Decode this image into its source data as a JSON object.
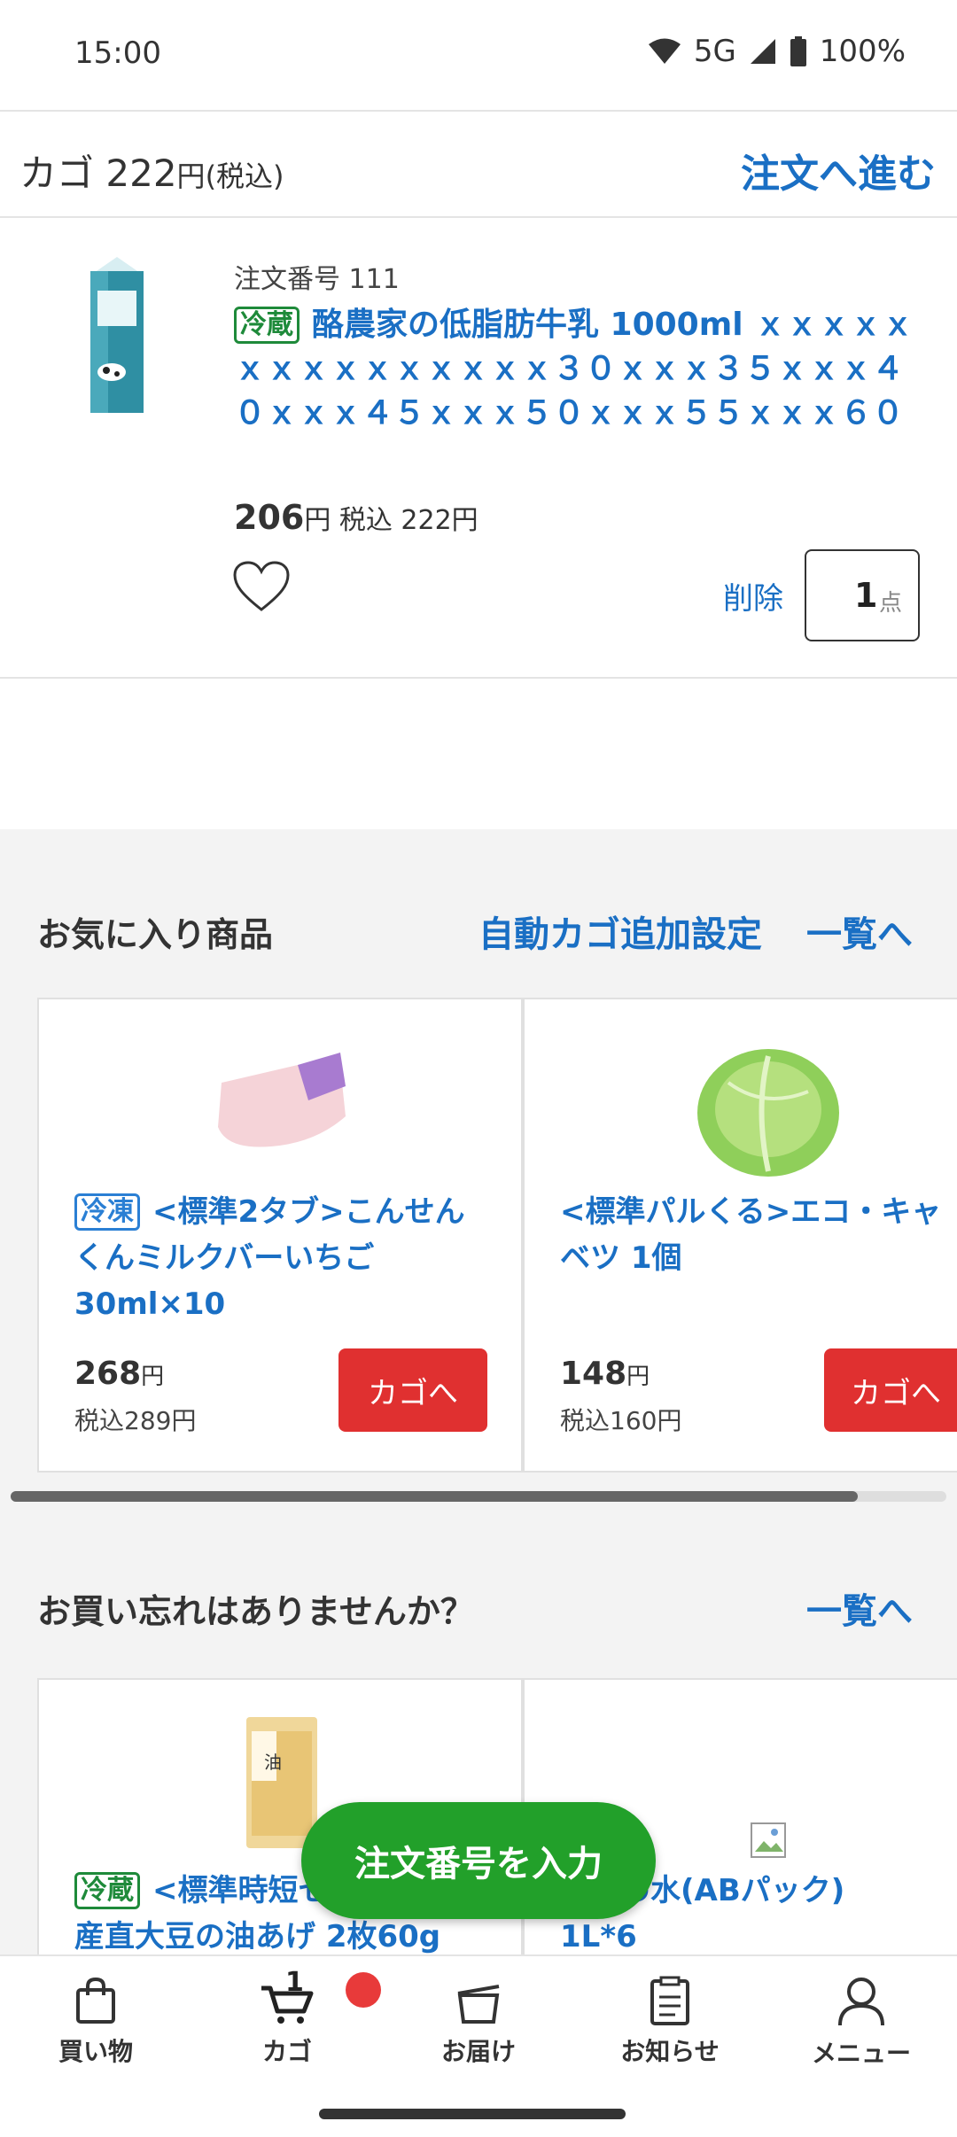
{
  "status_bar": {
    "time": "15:00",
    "network": "5G",
    "battery": "100%"
  },
  "cart_header": {
    "label": "カゴ",
    "total": "222",
    "unit": "円",
    "tax_note": "(税込)",
    "proceed_label": "注文へ進む"
  },
  "cart_item": {
    "order_number": "注文番号 111",
    "badge": "冷蔵",
    "name": "酪農家の低脂肪牛乳 1000ml ｘｘｘｘｘｘｘｘｘｘｘｘｘｘｘ３０ｘｘｘ３５ｘｘｘ４０ｘｘｘ４５ｘｘｘ５０ｘｘｘ５５ｘｘｘ６０",
    "price": "206",
    "price_unit": "円",
    "price_tax": "税込 222円",
    "delete_label": "削除",
    "quantity": "1",
    "quantity_unit": "点"
  },
  "favorites": {
    "title": "お気に入り商品",
    "auto_add_label": "自動カゴ追加設定",
    "list_link": "一覧へ",
    "products": [
      {
        "badge": "冷凍",
        "name_line1": "<標準2タブ>こんせん",
        "name_line2": "くんミルクバーいちご",
        "name_line3": "30ml×10",
        "price": "268",
        "price_unit": "円",
        "tax_price": "税込289円",
        "add_label": "カゴへ"
      },
      {
        "name_line1": "<標準パルくる>エコ・キャ",
        "name_line2": "ベツ 1個",
        "price": "148",
        "price_unit": "円",
        "tax_price": "税込160円",
        "add_label": "カゴへ"
      }
    ]
  },
  "forgotten": {
    "title": "お買い忘れはありませんか？",
    "list_link": "一覧へ",
    "products": [
      {
        "badge": "冷蔵",
        "name_line1": "<標準時短セ",
        "name_line2": "産直大豆の油あげ 2枚60g"
      },
      {
        "name_line1": "み野の水(ABパック)",
        "name_line2": "1L*6"
      }
    ]
  },
  "fab": {
    "label": "注文番号を入力"
  },
  "bottom_nav": {
    "items": [
      {
        "label": "買い物",
        "icon": "shopping-bag-icon"
      },
      {
        "label": "カゴ",
        "icon": "cart-icon",
        "count": "1"
      },
      {
        "label": "お届け",
        "icon": "delivery-box-icon"
      },
      {
        "label": "お知らせ",
        "icon": "notice-icon"
      },
      {
        "label": "メニュー",
        "icon": "person-icon"
      }
    ]
  },
  "colors": {
    "accent_blue": "#1a6fc4",
    "add_button_red": "#e03030",
    "fab_green": "#22a02a",
    "chilled_green": "#1e8a3a",
    "frozen_blue": "#2a7fd4"
  }
}
